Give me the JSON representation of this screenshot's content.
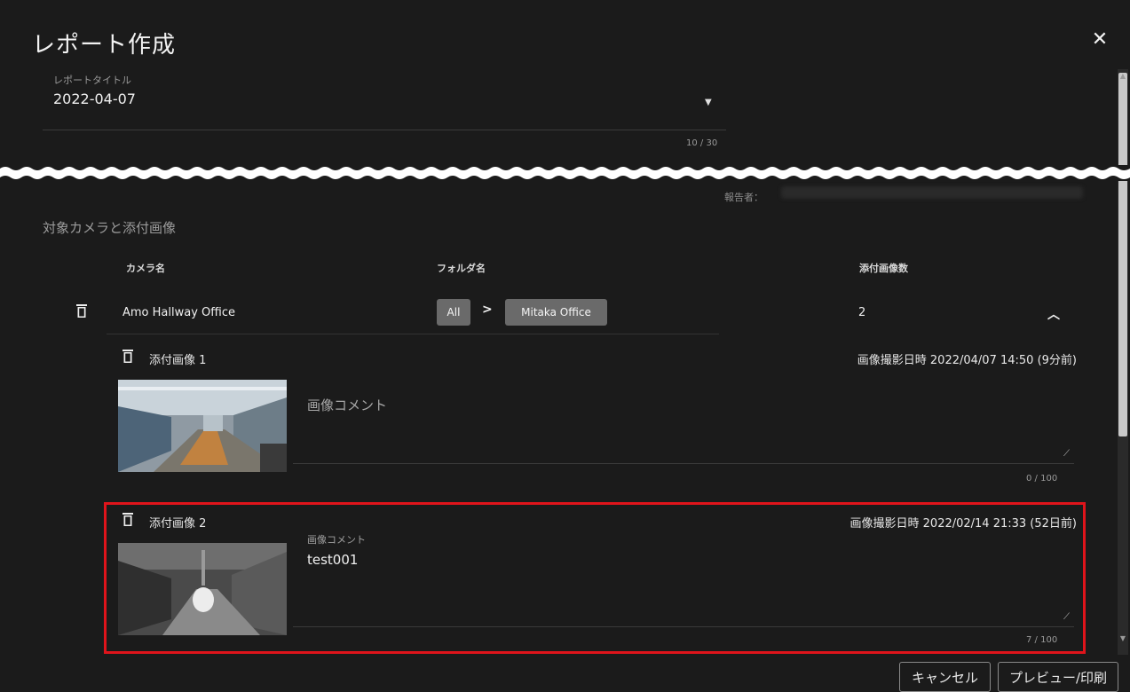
{
  "dialog": {
    "title": "レポート作成",
    "close_icon": "close-icon"
  },
  "report_title_field": {
    "label": "レポートタイトル",
    "value": "2022-04-07",
    "counter": "10 / 30",
    "dropdown_icon": "caret-down-icon"
  },
  "reporter": {
    "label": "報告者："
  },
  "section": {
    "label": "対象カメラと添付画像"
  },
  "table": {
    "headers": [
      "カメラ名",
      "フォルダ名",
      "添付画像数"
    ]
  },
  "camera": {
    "name": "Amo Hallway Office",
    "folder_path": [
      "All",
      "Mitaka Office"
    ],
    "separator": ">",
    "attachment_count": "2",
    "collapse_icon": "chevron-up-icon",
    "delete_icon": "trash-icon"
  },
  "attachments": [
    {
      "title": "添付画像 1",
      "captured": "画像撮影日時 2022/04/07 14:50 (9分前)",
      "comment_placeholder": "画像コメント",
      "comment_value": "",
      "counter": "0 / 100"
    },
    {
      "title": "添付画像 2",
      "captured": "画像撮影日時 2022/02/14 21:33 (52日前)",
      "comment_label": "画像コメント",
      "comment_value": "test001",
      "counter": "7 / 100"
    }
  ],
  "buttons": {
    "cancel": "キャンセル",
    "preview": "プレビュー/印刷"
  },
  "colors": {
    "background": "#1b1b1b",
    "highlight": "#e0141b",
    "chip": "#6a6a6a"
  }
}
